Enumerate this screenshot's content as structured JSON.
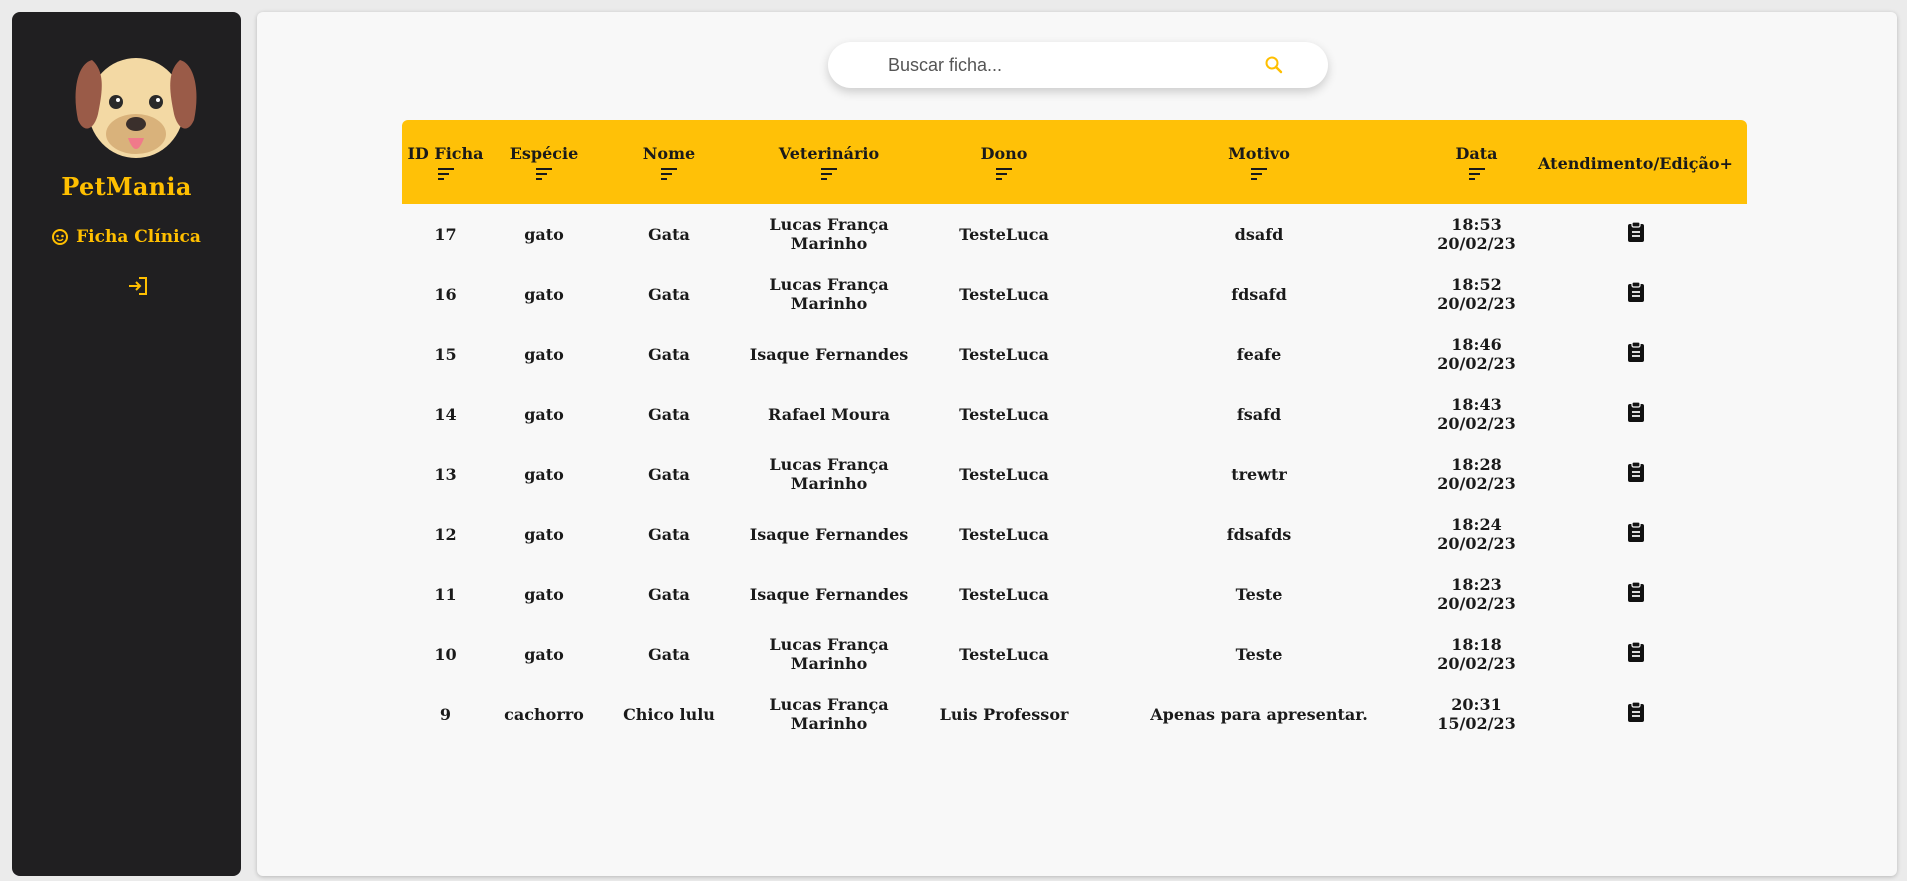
{
  "sidebar": {
    "brand": "PetMania",
    "nav_item": "Ficha Clínica",
    "icons": {
      "nav": "paw-emoji-icon",
      "logout": "logout-icon",
      "logo": "dog-face-logo"
    },
    "accent_color": "#ffbf00",
    "background_color": "#201f21"
  },
  "search": {
    "placeholder": "Buscar ficha...",
    "value": "",
    "icon": "search-icon"
  },
  "table": {
    "header_color": "#ffc107",
    "columns": [
      {
        "label": "ID Ficha",
        "sortable": true
      },
      {
        "label": "Espécie",
        "sortable": true
      },
      {
        "label": "Nome",
        "sortable": true
      },
      {
        "label": "Veterinário",
        "sortable": true
      },
      {
        "label": "Dono",
        "sortable": true
      },
      {
        "label": "Motivo",
        "sortable": true
      },
      {
        "label": "Data",
        "sortable": true
      },
      {
        "label": "Atendimento/Edição+",
        "sortable": false
      }
    ],
    "rows": [
      {
        "id": "17",
        "especie": "gato",
        "nome": "Gata",
        "veterinario": "Lucas França Marinho",
        "dono": "TesteLuca",
        "motivo": "dsafd",
        "hora": "18:53",
        "data": "20/02/23"
      },
      {
        "id": "16",
        "especie": "gato",
        "nome": "Gata",
        "veterinario": "Lucas França Marinho",
        "dono": "TesteLuca",
        "motivo": "fdsafd",
        "hora": "18:52",
        "data": "20/02/23"
      },
      {
        "id": "15",
        "especie": "gato",
        "nome": "Gata",
        "veterinario": "Isaque Fernandes",
        "dono": "TesteLuca",
        "motivo": "feafe",
        "hora": "18:46",
        "data": "20/02/23"
      },
      {
        "id": "14",
        "especie": "gato",
        "nome": "Gata",
        "veterinario": "Rafael Moura",
        "dono": "TesteLuca",
        "motivo": "fsafd",
        "hora": "18:43",
        "data": "20/02/23"
      },
      {
        "id": "13",
        "especie": "gato",
        "nome": "Gata",
        "veterinario": "Lucas França Marinho",
        "dono": "TesteLuca",
        "motivo": "trewtr",
        "hora": "18:28",
        "data": "20/02/23"
      },
      {
        "id": "12",
        "especie": "gato",
        "nome": "Gata",
        "veterinario": "Isaque Fernandes",
        "dono": "TesteLuca",
        "motivo": "fdsafds",
        "hora": "18:24",
        "data": "20/02/23"
      },
      {
        "id": "11",
        "especie": "gato",
        "nome": "Gata",
        "veterinario": "Isaque Fernandes",
        "dono": "TesteLuca",
        "motivo": "Teste",
        "hora": "18:23",
        "data": "20/02/23"
      },
      {
        "id": "10",
        "especie": "gato",
        "nome": "Gata",
        "veterinario": "Lucas França Marinho",
        "dono": "TesteLuca",
        "motivo": "Teste",
        "hora": "18:18",
        "data": "20/02/23"
      },
      {
        "id": "9",
        "especie": "cachorro",
        "nome": "Chico lulu",
        "veterinario": "Lucas França Marinho",
        "dono": "Luis Professor",
        "motivo": "Apenas para apresentar.",
        "hora": "20:31",
        "data": "15/02/23"
      }
    ],
    "action_icon": "clipboard-icon"
  }
}
